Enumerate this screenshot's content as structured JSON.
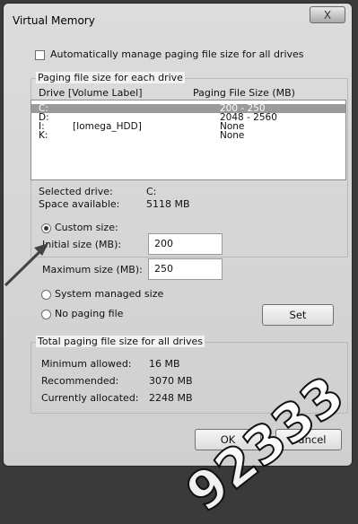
{
  "window": {
    "title": "Virtual Memory",
    "close_glyph": "X"
  },
  "auto_manage": {
    "label": "Automatically manage paging file size for all drives",
    "checked": false
  },
  "drives_group": {
    "legend": "Paging file size for each drive",
    "col_drive": "Drive  [Volume Label]",
    "col_size": "Paging File Size (MB)",
    "rows": [
      {
        "drive": "C:",
        "label": "",
        "size": "200 - 250",
        "selected": true
      },
      {
        "drive": "D:",
        "label": "",
        "size": "2048 - 2560",
        "selected": false
      },
      {
        "drive": "I:",
        "label": "[Iomega_HDD]",
        "size": "None",
        "selected": false
      },
      {
        "drive": "K:",
        "label": "",
        "size": "None",
        "selected": false
      }
    ]
  },
  "selected_drive": {
    "label": "Selected drive:",
    "value": "C:"
  },
  "space_available": {
    "label": "Space available:",
    "value": "5118 MB"
  },
  "options": {
    "custom_size": {
      "label": "Custom size:",
      "selected": true
    },
    "initial_size": {
      "label": "Initial size (MB):",
      "value": "200"
    },
    "maximum_size": {
      "label": "Maximum size (MB):",
      "value": "250"
    },
    "system_managed": {
      "label": "System managed size",
      "selected": false
    },
    "no_paging": {
      "label": "No paging file",
      "selected": false
    },
    "set_label": "Set"
  },
  "totals": {
    "legend": "Total paging file size for all drives",
    "minimum": {
      "label": "Minimum allowed:",
      "value": "16 MB"
    },
    "recommended": {
      "label": "Recommended:",
      "value": "3070 MB"
    },
    "allocated": {
      "label": "Currently allocated:",
      "value": "2248 MB"
    }
  },
  "buttons": {
    "ok": "OK",
    "cancel": "Cancel"
  },
  "watermark": "92333"
}
